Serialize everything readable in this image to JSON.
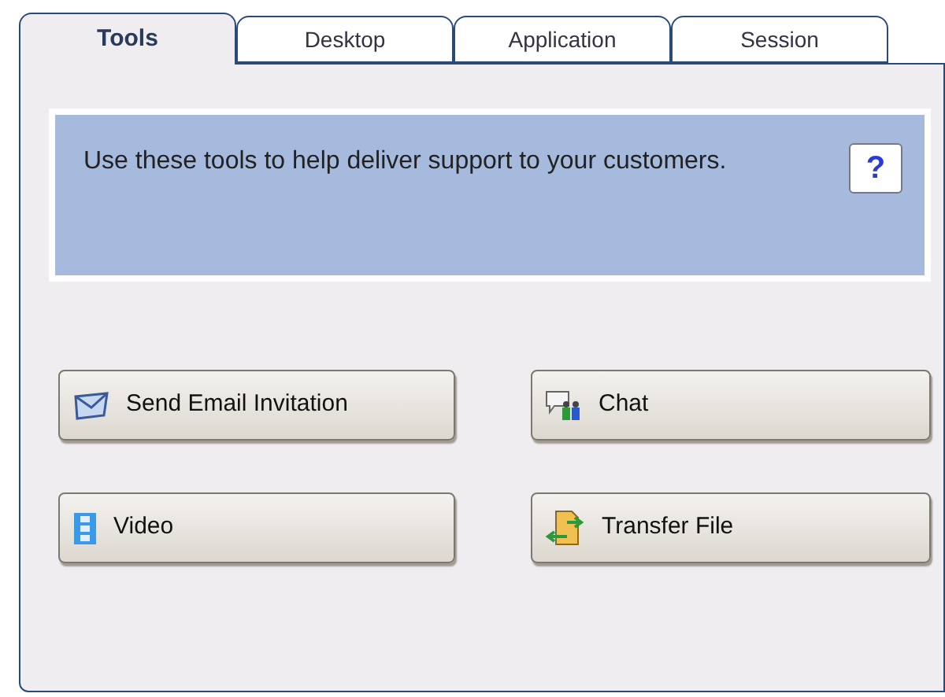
{
  "tabs": [
    {
      "label": "Tools",
      "selected": true
    },
    {
      "label": "Desktop",
      "selected": false
    },
    {
      "label": "Application",
      "selected": false
    },
    {
      "label": "Session",
      "selected": false
    }
  ],
  "info": {
    "text": "Use these tools to help deliver support to your customers.",
    "help": "?"
  },
  "buttons": [
    {
      "label": "Send Email Invitation",
      "kind": "email"
    },
    {
      "label": "Chat",
      "kind": "chat"
    },
    {
      "label": "Video",
      "kind": "video"
    },
    {
      "label": "Transfer File",
      "kind": "transfer"
    }
  ]
}
